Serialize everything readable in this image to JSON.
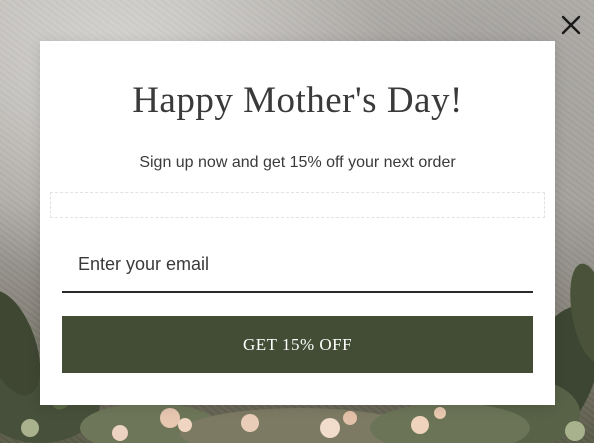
{
  "popup": {
    "title": "Happy Mother's Day!",
    "subtitle": "Sign up now and get 15% off your next order",
    "email_placeholder": "Enter your email",
    "email_value": "",
    "cta_label": "GET 15% OFF",
    "close_icon": "close-icon"
  },
  "colors": {
    "cta_background": "#434d35",
    "cta_text": "#ffffff",
    "text": "#3a3a3a",
    "modal_background": "#ffffff"
  }
}
